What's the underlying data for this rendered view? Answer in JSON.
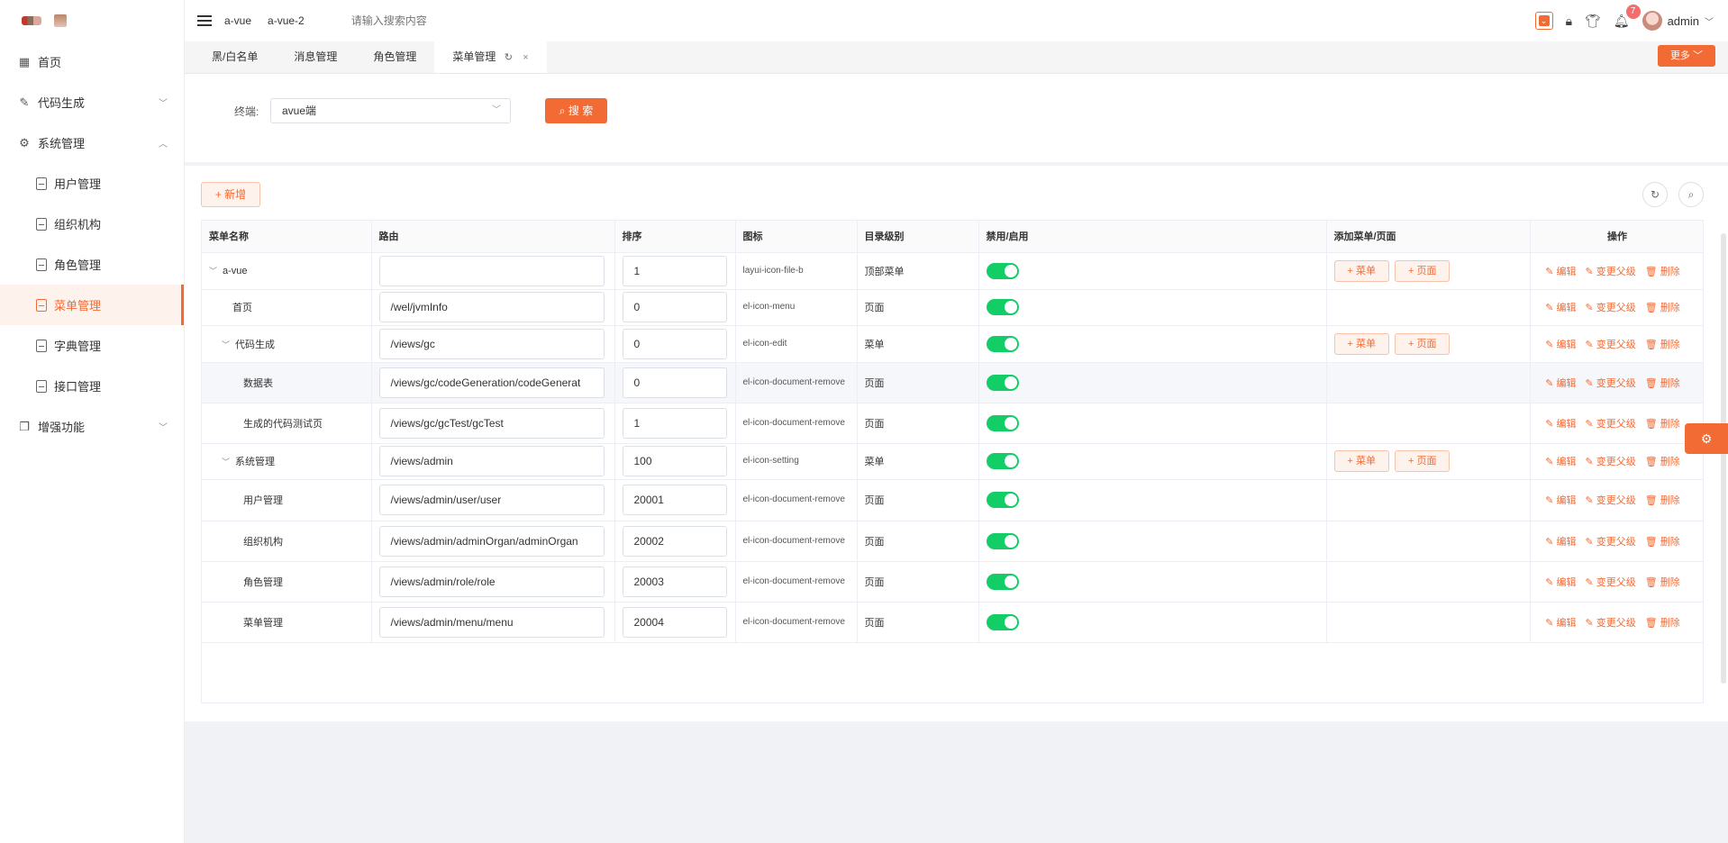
{
  "sidebar": {
    "items": [
      {
        "label": "首页",
        "icon": "grid-icon"
      },
      {
        "label": "代码生成",
        "icon": "edit-icon"
      },
      {
        "label": "系统管理",
        "icon": "gear-icon"
      },
      {
        "label": "用户管理"
      },
      {
        "label": "组织机构"
      },
      {
        "label": "角色管理"
      },
      {
        "label": "菜单管理"
      },
      {
        "label": "字典管理"
      },
      {
        "label": "接口管理"
      },
      {
        "label": "增强功能",
        "icon": "copy-icon"
      }
    ]
  },
  "topbar": {
    "links": [
      "a-vue",
      "a-vue-2"
    ],
    "search_placeholder": "请输入搜索内容",
    "badge_count": "7",
    "user": "admin"
  },
  "tabs": [
    "黑/白名单",
    "消息管理",
    "角色管理",
    "菜单管理"
  ],
  "more_label": "更多",
  "search": {
    "terminal_label": "终端:",
    "terminal_value": "avue端",
    "search_button": "搜 索"
  },
  "table": {
    "add_label": "新增",
    "headers": [
      "菜单名称",
      "路由",
      "排序",
      "图标",
      "目录级别",
      "禁用/启用",
      "添加菜单/页面",
      "操作"
    ],
    "add_menu_label": "菜单",
    "add_page_label": "页面",
    "op_edit": "编辑",
    "op_parent": "变更父级",
    "op_delete": "删除",
    "rows": [
      {
        "name": "a-vue",
        "route": "",
        "sort": "1",
        "icon": "layui-icon-file-b",
        "level": "顶部菜单"
      },
      {
        "name": "首页",
        "route": "/wel/jvmInfo",
        "sort": "0",
        "icon": "el-icon-menu",
        "level": "页面"
      },
      {
        "name": "代码生成",
        "route": "/views/gc",
        "sort": "0",
        "icon": "el-icon-edit",
        "level": "菜单"
      },
      {
        "name": "数据表",
        "route": "/views/gc/codeGeneration/codeGenerat",
        "sort": "0",
        "icon": "el-icon-document-remove",
        "level": "页面"
      },
      {
        "name": "生成的代码测试页",
        "route": "/views/gc/gcTest/gcTest",
        "sort": "1",
        "icon": "el-icon-document-remove",
        "level": "页面"
      },
      {
        "name": "系统管理",
        "route": "/views/admin",
        "sort": "100",
        "icon": "el-icon-setting",
        "level": "菜单"
      },
      {
        "name": "用户管理",
        "route": "/views/admin/user/user",
        "sort": "20001",
        "icon": "el-icon-document-remove",
        "level": "页面"
      },
      {
        "name": "组织机构",
        "route": "/views/admin/adminOrgan/adminOrgan",
        "sort": "20002",
        "icon": "el-icon-document-remove",
        "level": "页面"
      },
      {
        "name": "角色管理",
        "route": "/views/admin/role/role",
        "sort": "20003",
        "icon": "el-icon-document-remove",
        "level": "页面"
      },
      {
        "name": "菜单管理",
        "route": "/views/admin/menu/menu",
        "sort": "20004",
        "icon": "el-icon-document-remove",
        "level": "页面"
      }
    ]
  },
  "colors": {
    "accent": "#f26b35",
    "switch_on": "#13ce66"
  }
}
